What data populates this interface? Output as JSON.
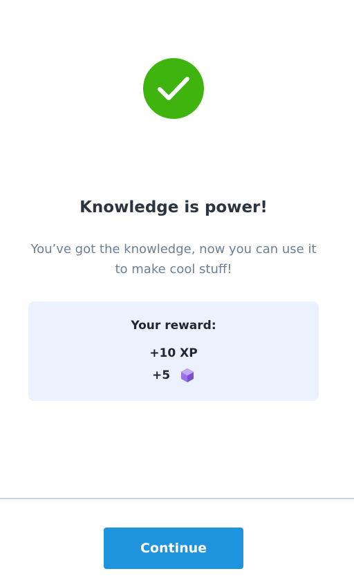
{
  "completion": {
    "icon": "checkmark-icon",
    "icon_color": "#3fb40f",
    "title": "Knowledge is power!",
    "subtitle": "You’ve got the knowledge, now you can use it to make cool stuff!"
  },
  "reward": {
    "heading": "Your reward:",
    "xp": "+10 XP",
    "gems": "+5",
    "gem_icon": "purple-cube-icon"
  },
  "footer": {
    "continue_label": "Continue",
    "button_color": "#2093df"
  }
}
